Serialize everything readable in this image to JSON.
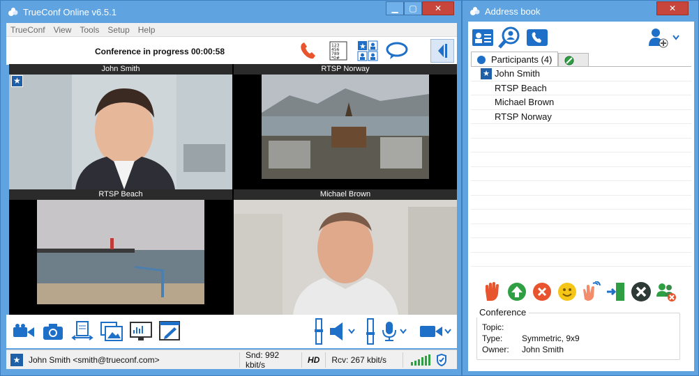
{
  "main": {
    "title": "TrueConf Online v6.5.1",
    "menu": [
      "TrueConf",
      "View",
      "Tools",
      "Setup",
      "Help"
    ],
    "conference_status": "Conference in progress 00:00:58",
    "tiles": [
      {
        "label": "John Smith"
      },
      {
        "label": "RTSP Norway"
      },
      {
        "label": "RTSP Beach"
      },
      {
        "label": "Michael Brown"
      }
    ],
    "status": {
      "user": "John Smith <smith@trueconf.com>",
      "snd": "Snd: 992 kbit/s",
      "hd": "HD",
      "rcv": "Rcv: 267 kbit/s"
    }
  },
  "address_book": {
    "title": "Address book",
    "tab_participants": "Participants (4)",
    "participants": [
      "John Smith",
      "RTSP Beach",
      "Michael Brown",
      "RTSP Norway"
    ],
    "conference": {
      "heading": "Conference",
      "topic_label": "Topic:",
      "topic_value": "",
      "type_label": "Type:",
      "type_value": "Symmetric, 9x9",
      "owner_label": "Owner:",
      "owner_value": "John Smith"
    }
  },
  "colors": {
    "window_frame": "#5fa3e0",
    "accent_blue": "#1e6fc7",
    "call_orange": "#e8542e",
    "close_red": "#c7453b"
  }
}
